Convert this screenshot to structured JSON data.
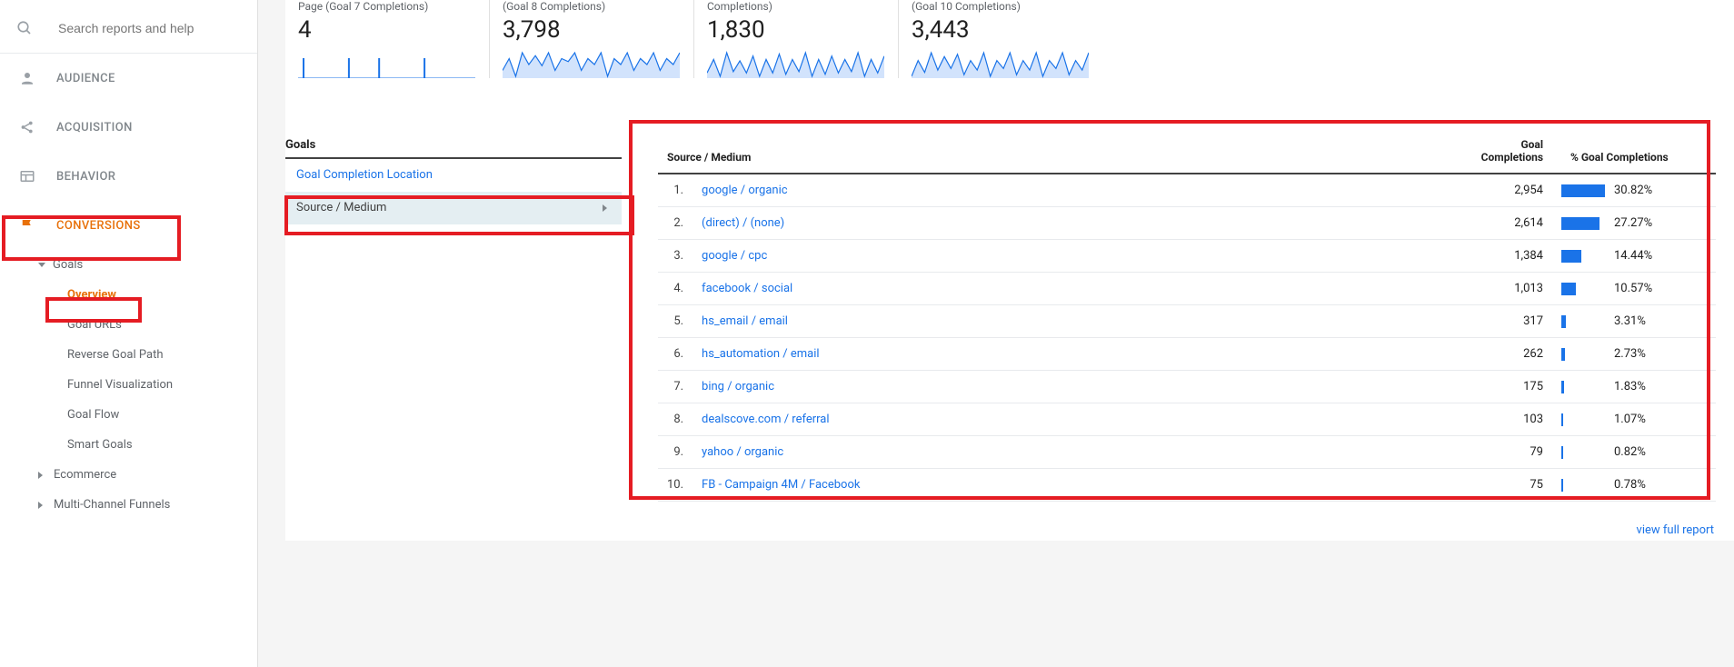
{
  "search": {
    "placeholder": "Search reports and help"
  },
  "nav": {
    "audience": "AUDIENCE",
    "acquisition": "ACQUISITION",
    "behavior": "BEHAVIOR",
    "conversions": "CONVERSIONS"
  },
  "conversions_menu": {
    "goals": "Goals",
    "overview": "Overview",
    "goal_urls": "Goal URLs",
    "reverse": "Reverse Goal Path",
    "funnel": "Funnel Visualization",
    "flow": "Goal Flow",
    "smart": "Smart Goals",
    "ecommerce": "Ecommerce",
    "mcf": "Multi-Channel Funnels"
  },
  "scorecards": [
    {
      "subtitle": "Page (Goal 7 Completions)",
      "value": "4"
    },
    {
      "subtitle": "(Goal 8 Completions)",
      "value": "3,798"
    },
    {
      "subtitle": "Completions)",
      "value": "1,830"
    },
    {
      "subtitle": "(Goal 10 Completions)",
      "value": "3,443"
    }
  ],
  "dim_panel": {
    "heading": "Goals",
    "items": [
      "Goal Completion Location",
      "Source / Medium"
    ],
    "active_index": 1
  },
  "table": {
    "dim_header": "Source / Medium",
    "metric_header": "Goal Completions",
    "pct_header": "% Goal Completions",
    "rows": [
      {
        "rank": "1.",
        "name": "google / organic",
        "value": "2,954",
        "pct": "30.82%",
        "bar": 30.82
      },
      {
        "rank": "2.",
        "name": "(direct) / (none)",
        "value": "2,614",
        "pct": "27.27%",
        "bar": 27.27
      },
      {
        "rank": "3.",
        "name": "google / cpc",
        "value": "1,384",
        "pct": "14.44%",
        "bar": 14.44
      },
      {
        "rank": "4.",
        "name": "facebook / social",
        "value": "1,013",
        "pct": "10.57%",
        "bar": 10.57
      },
      {
        "rank": "5.",
        "name": "hs_email / email",
        "value": "317",
        "pct": "3.31%",
        "bar": 3.31
      },
      {
        "rank": "6.",
        "name": "hs_automation / email",
        "value": "262",
        "pct": "2.73%",
        "bar": 2.73
      },
      {
        "rank": "7.",
        "name": "bing / organic",
        "value": "175",
        "pct": "1.83%",
        "bar": 1.83
      },
      {
        "rank": "8.",
        "name": "dealscove.com / referral",
        "value": "103",
        "pct": "1.07%",
        "bar": 1.07
      },
      {
        "rank": "9.",
        "name": "yahoo / organic",
        "value": "79",
        "pct": "0.82%",
        "bar": 0.82
      },
      {
        "rank": "10.",
        "name": "FB - Campaign 4M / Facebook",
        "value": "75",
        "pct": "0.78%",
        "bar": 0.78
      }
    ]
  },
  "view_full": "view full report",
  "chart_data": [
    {
      "type": "line",
      "title": "Page (Goal 7 Completions)",
      "value_label": "4",
      "series": [
        {
          "name": "completions",
          "values": [
            1,
            0,
            0,
            1,
            0,
            1,
            0,
            0,
            1,
            0,
            0,
            0
          ]
        }
      ]
    },
    {
      "type": "line",
      "title": "(Goal 8 Completions)",
      "value_label": "3,798",
      "series": [
        {
          "name": "completions",
          "values": [
            120,
            140,
            110,
            150,
            130,
            145,
            128,
            150,
            120,
            140,
            135,
            150,
            120,
            140,
            130,
            150,
            110,
            140,
            130,
            150,
            120,
            140,
            130,
            150,
            120,
            140,
            130,
            150
          ]
        }
      ]
    },
    {
      "type": "line",
      "title": "Completions)",
      "value_label": "1,830",
      "series": [
        {
          "name": "completions",
          "values": [
            60,
            80,
            55,
            90,
            62,
            78,
            60,
            85,
            55,
            80,
            60,
            88,
            58,
            80,
            62,
            90,
            55,
            80,
            58,
            85,
            60,
            80,
            62,
            90,
            55,
            80,
            60,
            85
          ]
        }
      ]
    },
    {
      "type": "line",
      "title": "(Goal 10 Completions)",
      "value_label": "3,443",
      "series": [
        {
          "name": "completions",
          "values": [
            110,
            130,
            115,
            140,
            118,
            135,
            120,
            138,
            112,
            130,
            118,
            140,
            110,
            130,
            120,
            140,
            112,
            130,
            118,
            140,
            110,
            130,
            120,
            140,
            112,
            130,
            118,
            140
          ]
        }
      ]
    }
  ]
}
